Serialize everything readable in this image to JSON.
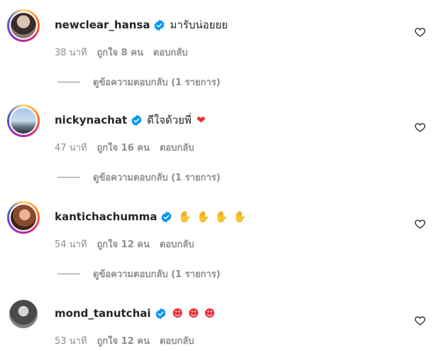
{
  "comments": [
    {
      "username": "newclear_hansa",
      "text": "มารับน่อยยย",
      "time": "38 นาที",
      "likes": "ถูกใจ 8 คน",
      "reply_label": "ตอบกลับ",
      "view_replies": "ดูข้อความตอบกลับ (1 รายการ)",
      "verified": true,
      "story_ring": true,
      "trailing_emoji": []
    },
    {
      "username": "nickynachat",
      "text": "ดีใจด้วยพี่",
      "time": "47 นาที",
      "likes": "ถูกใจ 16 คน",
      "reply_label": "ตอบกลับ",
      "view_replies": "ดูข้อความตอบกลับ (1 รายการ)",
      "verified": true,
      "story_ring": true,
      "trailing_emoji": [
        "red-heart"
      ]
    },
    {
      "username": "kantichachumma",
      "text": "",
      "time": "54 นาที",
      "likes": "ถูกใจ 12 คน",
      "reply_label": "ตอบกลับ",
      "view_replies": "ดูข้อความตอบกลับ (1 รายการ)",
      "verified": true,
      "story_ring": true,
      "trailing_emoji": [
        "clapping-hands",
        "clapping-hands",
        "clapping-hands",
        "clapping-hands"
      ]
    },
    {
      "username": "mond_tanutchai",
      "text": "",
      "time": "53 นาที",
      "likes": "ถูกใจ 12 คน",
      "reply_label": "ตอบกลับ",
      "verified": true,
      "story_ring": false,
      "trailing_emoji": [
        "heart-eyes-face",
        "heart-eyes-face",
        "heart-eyes-face"
      ]
    }
  ],
  "colors": {
    "text": "#262626",
    "secondary": "#8e8e8e",
    "verified": "#0095f6",
    "heart": "#ed2f3a"
  }
}
